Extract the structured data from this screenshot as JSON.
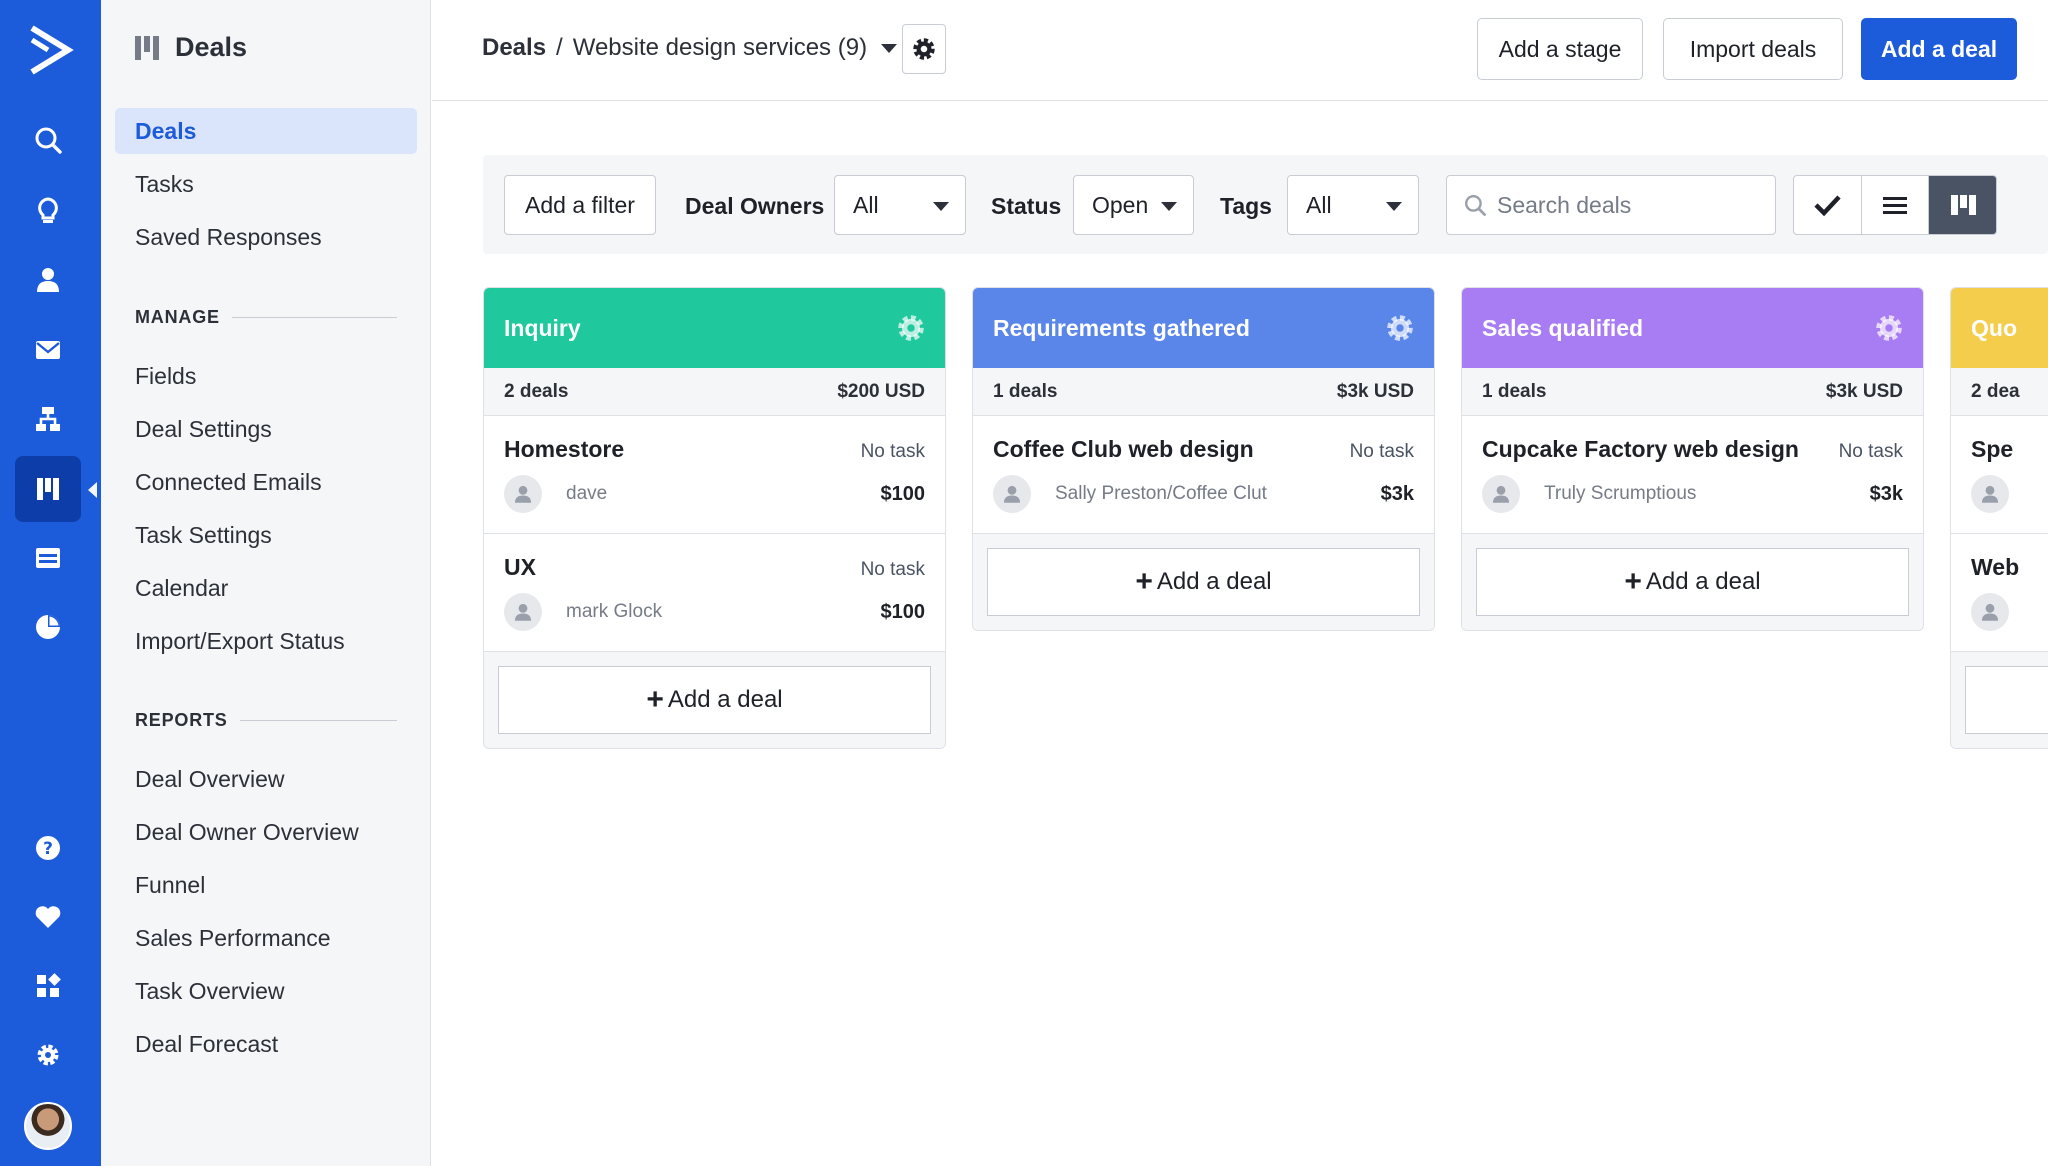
{
  "nav": {
    "items": [
      {
        "icon": "search-icon",
        "active": false
      },
      {
        "icon": "lightbulb-icon",
        "active": false
      },
      {
        "icon": "person-icon",
        "active": false
      },
      {
        "icon": "envelope-icon",
        "active": false
      },
      {
        "icon": "automation-icon",
        "active": false
      },
      {
        "icon": "deals-pipeline-icon",
        "active": true
      },
      {
        "icon": "site-icon",
        "active": false
      },
      {
        "icon": "reports-pie-icon",
        "active": false
      }
    ],
    "bottom_items": [
      "help-icon",
      "heart-icon",
      "apps-icon",
      "settings-icon"
    ],
    "brand_color": "#1c5bd9"
  },
  "sidebar": {
    "title": "Deals",
    "items": [
      {
        "label": "Deals",
        "active": true
      },
      {
        "label": "Tasks",
        "active": false
      },
      {
        "label": "Saved Responses",
        "active": false
      }
    ],
    "manage": {
      "heading": "MANAGE",
      "items": [
        "Fields",
        "Deal Settings",
        "Connected Emails",
        "Task Settings",
        "Calendar",
        "Import/Export Status"
      ]
    },
    "reports": {
      "heading": "REPORTS",
      "items": [
        "Deal Overview",
        "Deal Owner Overview",
        "Funnel",
        "Sales Performance",
        "Task Overview",
        "Deal Forecast"
      ]
    }
  },
  "header": {
    "breadcrumb_root": "Deals",
    "separator": "/",
    "pipeline": "Website design services (9)",
    "add_stage": "Add a stage",
    "import_deals": "Import deals",
    "add_deal": "Add a deal"
  },
  "filters": {
    "add_filter": "Add a filter",
    "deal_owners_label": "Deal Owners",
    "deal_owners_value": "All",
    "status_label": "Status",
    "status_value": "Open",
    "tags_label": "Tags",
    "tags_value": "All",
    "search_placeholder": "Search deals",
    "view_mode": "kanban"
  },
  "stages": [
    {
      "name": "Inquiry",
      "color": "#1fc99d",
      "count": "2 deals",
      "total": "$200 USD",
      "deals": [
        {
          "title": "Homestore",
          "task": "No task",
          "owner": "dave",
          "value": "$100"
        },
        {
          "title": "UX",
          "task": "No task",
          "owner": "mark Glock",
          "value": "$100"
        }
      ],
      "add_label": "Add a deal"
    },
    {
      "name": "Requirements gathered",
      "color": "#5a86ea",
      "count": "1 deals",
      "total": "$3k USD",
      "deals": [
        {
          "title": "Coffee Club web design",
          "task": "No task",
          "owner": "Sally Preston/Coffee Clut",
          "value": "$3k"
        }
      ],
      "add_label": "Add a deal"
    },
    {
      "name": "Sales qualified",
      "color": "#a87df4",
      "count": "1 deals",
      "total": "$3k USD",
      "deals": [
        {
          "title": "Cupcake Factory web design",
          "task": "No task",
          "owner": "Truly Scrumptious",
          "value": "$3k"
        }
      ],
      "add_label": "Add a deal"
    },
    {
      "name": "Quo",
      "color": "#f4cd4c",
      "count": "2 dea",
      "total": "",
      "deals": [
        {
          "title": "Spe",
          "task": "",
          "owner": "",
          "value": ""
        },
        {
          "title": "Web",
          "task": "",
          "owner": "",
          "value": ""
        }
      ],
      "add_label": ""
    }
  ]
}
